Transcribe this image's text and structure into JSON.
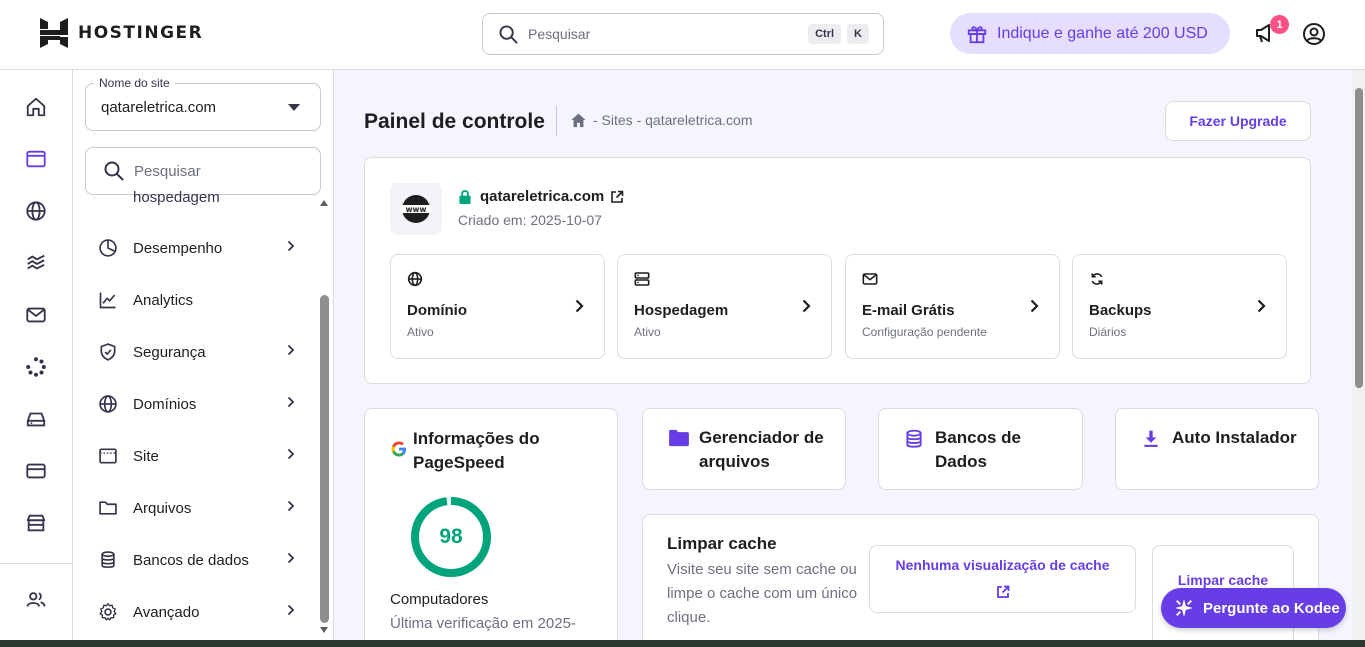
{
  "header": {
    "brand": "HOSTINGER",
    "search_placeholder": "Pesquisar",
    "shortcut_key1": "Ctrl",
    "shortcut_key2": "K",
    "referral_label": "Indique e ganhe até 200 USD",
    "notification_count": "1"
  },
  "sidebar": {
    "site_select_label": "Nome do site",
    "site_select_value": "qatareletrica.com",
    "search_placeholder": "Pesquisar",
    "clipped_item": "hospedagem",
    "items": [
      {
        "label": "Desempenho",
        "icon": "pie-chart-icon",
        "has_chevron": true
      },
      {
        "label": "Analytics",
        "icon": "analytics-icon",
        "has_chevron": false
      },
      {
        "label": "Segurança",
        "icon": "shield-icon",
        "has_chevron": true
      },
      {
        "label": "Domínios",
        "icon": "globe-icon",
        "has_chevron": true
      },
      {
        "label": "Site",
        "icon": "browser-icon",
        "has_chevron": true
      },
      {
        "label": "Arquivos",
        "icon": "folder-icon",
        "has_chevron": true
      },
      {
        "label": "Bancos de dados",
        "icon": "database-icon",
        "has_chevron": true
      },
      {
        "label": "Avançado",
        "icon": "gear-icon",
        "has_chevron": true
      }
    ]
  },
  "main": {
    "title": "Painel de controle",
    "breadcrumb": "- Sites - qatareletrica.com",
    "upgrade_label": "Fazer Upgrade",
    "site": {
      "name": "qatareletrica.com",
      "created": "Criado em: 2025-10-07"
    },
    "tiles": [
      {
        "title": "Domínio",
        "status": "Ativo",
        "icon": "globe-icon"
      },
      {
        "title": "Hospedagem",
        "status": "Ativo",
        "icon": "server-icon"
      },
      {
        "title": "E-mail Grátis",
        "status": "Configuração pendente",
        "icon": "mail-icon"
      },
      {
        "title": "Backups",
        "status": "Diários",
        "icon": "refresh-icon"
      }
    ],
    "pagespeed": {
      "title": "Informações do PageSpeed",
      "score": "98",
      "score_value": 98,
      "device": "Computadores",
      "last_check": "Última verificação em 2025-",
      "score_color": "#00a47c"
    },
    "quick_actions": [
      {
        "label": "Gerenciador de arquivos",
        "icon": "folder-icon"
      },
      {
        "label": "Bancos de Dados",
        "icon": "database-icon"
      },
      {
        "label": "Auto Instalador",
        "icon": "download-icon"
      }
    ],
    "cache": {
      "title": "Limpar cache",
      "description": "Visite seu site sem cache ou limpe o cache com um único clique.",
      "preview_label": "Nenhuma visualização de cache",
      "clear_label": "Limpar cache"
    },
    "kodee_label": "Pergunte ao Kodee"
  },
  "colors": {
    "accent": "#673de6",
    "accent_soft": "#e5deff",
    "badge": "#fc5185",
    "success": "#00a47c"
  }
}
